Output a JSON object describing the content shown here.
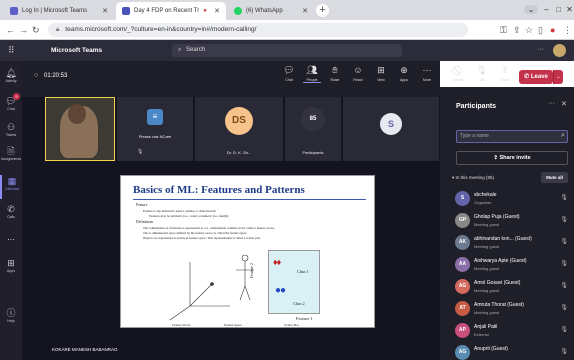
{
  "browser": {
    "tabs": [
      {
        "label": "Log In | Microsoft Teams",
        "active": false
      },
      {
        "label": "Day 4 FDP on Recent Tr",
        "active": true
      },
      {
        "label": "(6) WhatsApp",
        "active": false
      }
    ],
    "url": "teams.microsoft.com/_?culture=en-in&country=in#/modern-calling/"
  },
  "teams": {
    "app_title": "Microsoft Teams",
    "search_placeholder": "Search",
    "rail": [
      {
        "label": "Activity",
        "icon": "bell-icon"
      },
      {
        "label": "Chat",
        "icon": "chat-icon",
        "badge": "9"
      },
      {
        "label": "Teams",
        "icon": "teams-icon"
      },
      {
        "label": "Assignments",
        "icon": "assignments-icon"
      },
      {
        "label": "Calendar",
        "icon": "calendar-icon",
        "active": true
      },
      {
        "label": "Calls",
        "icon": "phone-icon"
      },
      {
        "label": "...",
        "icon": "more-icon"
      },
      {
        "label": "Apps",
        "icon": "apps-icon"
      },
      {
        "label": "Help",
        "icon": "help-icon"
      }
    ]
  },
  "meeting": {
    "timer": "01:20:53",
    "toolbar": [
      {
        "label": "Chat"
      },
      {
        "label": "People"
      },
      {
        "label": "Raise"
      },
      {
        "label": "React"
      },
      {
        "label": "View"
      },
      {
        "label": "Apps"
      },
      {
        "label": "More"
      },
      {
        "label": "Camera"
      },
      {
        "label": "Mic"
      },
      {
        "label": "Share"
      }
    ],
    "leave_label": "Leave",
    "tiles": [
      {
        "name": "Please rais NCare",
        "initials": ""
      },
      {
        "name": "Dr. D. K. Sh...",
        "initials": "DS"
      },
      {
        "name": "Participants",
        "initials": "85"
      },
      {
        "name": "",
        "initials": "S"
      }
    ],
    "presenter": "KOKARE MANESH BABANRAO"
  },
  "slide": {
    "title": "Basics of ML: Features and Patterns",
    "bullets": [
      "Feature",
      "Feature is any distinctive aspect, quality, or characteristic",
      "Features may be symbolic (i.e., color) or numeric (i.e., height)",
      "Definitions",
      "The combination of d features is represented as a d - dimensional column vector called a feature vector.",
      "The d- dimensional space defined by the feature vector is called the feature space",
      "Objects are represented as points in feature space. This representation is called a scatter plot"
    ],
    "labels": {
      "feature_vector": "Feature Vector",
      "feature_space": "Feature Space",
      "scatter_plot": "Scatter Plot",
      "class1": "Class 1",
      "class2": "Class 2",
      "feature1": "Feature 1",
      "feature2": "Feature 2"
    }
  },
  "panel": {
    "title": "Participants",
    "search_placeholder": "Type a name",
    "share_invite": "Share invite",
    "in_meeting": "In this meeting (85)",
    "mute_all": "Mute all",
    "participants": [
      {
        "initials": "S",
        "name": "sbchekale",
        "role": "Organizer",
        "color": "#6264a7"
      },
      {
        "initials": "GP",
        "name": "Gholap Puja (Guest)",
        "role": "Meeting guest",
        "color": "#8a8886"
      },
      {
        "initials": "AK",
        "name": "abhinandan kon... (Guest)",
        "role": "Meeting guest",
        "color": "#6b7a8f"
      },
      {
        "initials": "AA",
        "name": "Aishwarya Apte (Guest)",
        "role": "Meeting guest",
        "color": "#8a6ea8"
      },
      {
        "initials": "AG",
        "name": "Amol Gosavi (Guest)",
        "role": "Meeting guest",
        "color": "#d36a5e"
      },
      {
        "initials": "AT",
        "name": "Amruta Thorat (Guest)",
        "role": "Meeting guest",
        "color": "#c75a45"
      },
      {
        "initials": "AP",
        "name": "Anjali Patil",
        "role": "External",
        "color": "#c94f7c"
      },
      {
        "initials": "AG",
        "name": "Anuprit (Guest)",
        "role": "",
        "color": "#5a8bb0"
      }
    ]
  }
}
